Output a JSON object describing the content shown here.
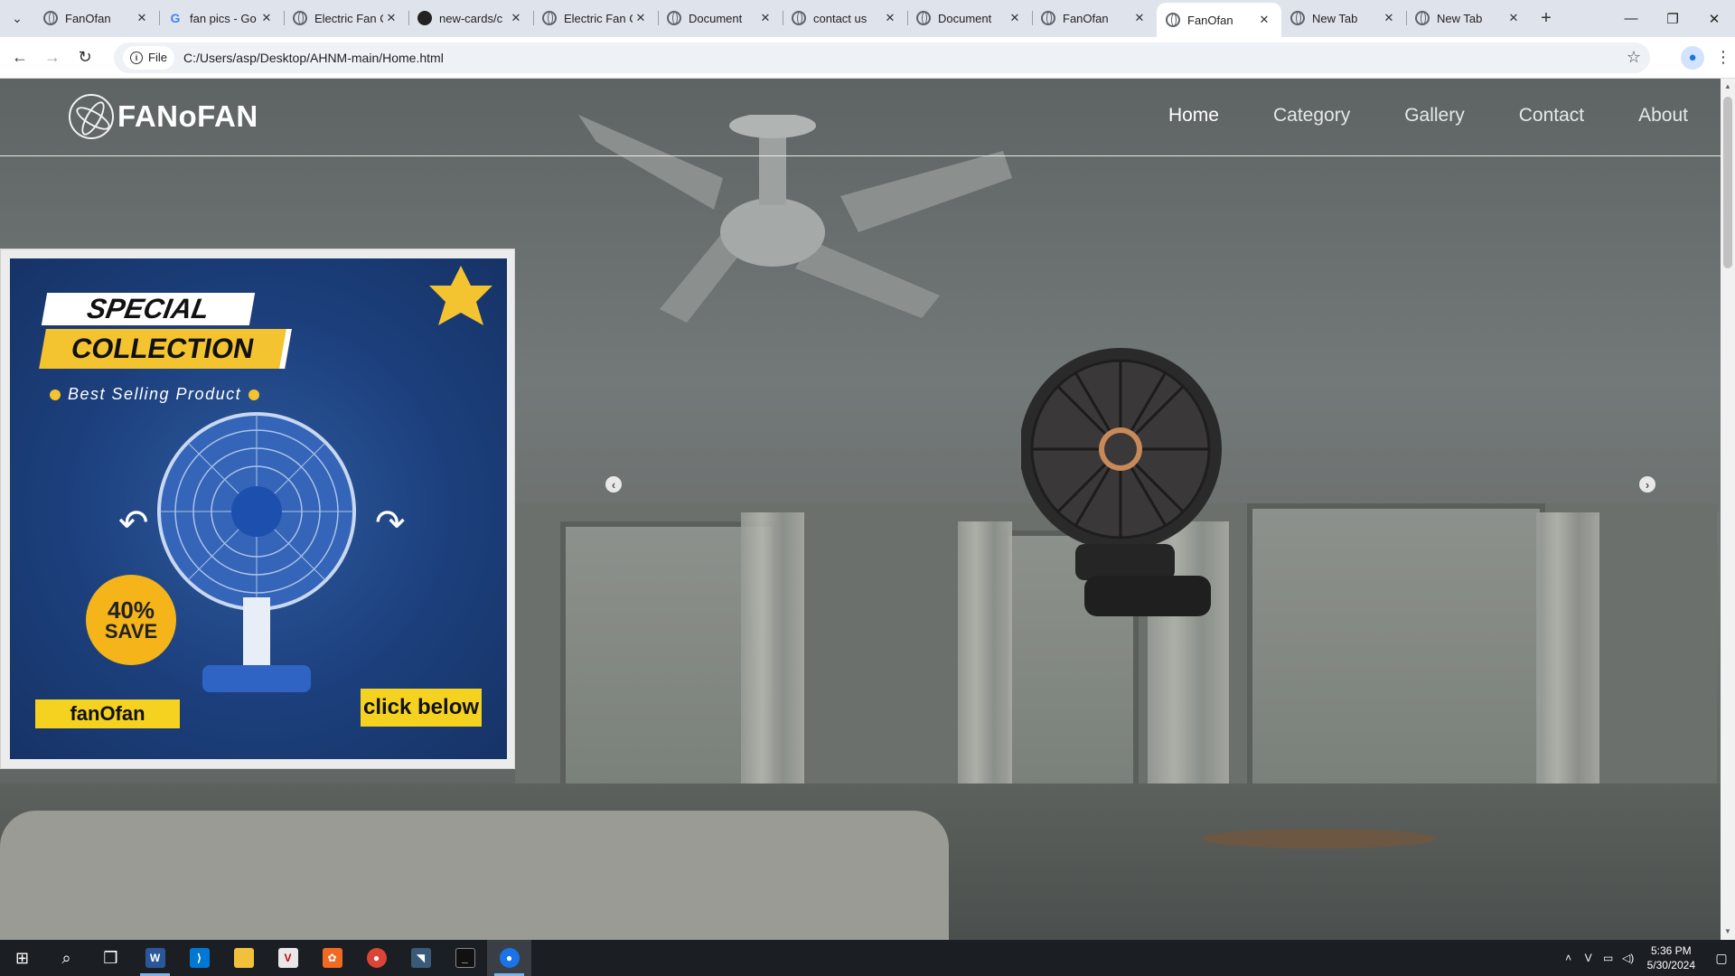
{
  "browser": {
    "tabs": [
      {
        "title": "FanOfan",
        "favicon": "globe-icon",
        "active": false
      },
      {
        "title": "fan pics - Go",
        "favicon": "google-icon",
        "active": false
      },
      {
        "title": "Electric Fan C",
        "favicon": "globe-icon",
        "active": false
      },
      {
        "title": "new-cards/c",
        "favicon": "github-icon",
        "active": false
      },
      {
        "title": "Electric Fan C",
        "favicon": "globe-icon",
        "active": false
      },
      {
        "title": "Document",
        "favicon": "globe-icon",
        "active": false
      },
      {
        "title": "contact us",
        "favicon": "globe-icon",
        "active": false
      },
      {
        "title": "Document",
        "favicon": "globe-icon",
        "active": false
      },
      {
        "title": "FanOfan",
        "favicon": "globe-icon",
        "active": false
      },
      {
        "title": "FanOfan",
        "favicon": "globe-icon",
        "active": true
      },
      {
        "title": "New Tab",
        "favicon": "chrome-icon",
        "active": false
      },
      {
        "title": "New Tab",
        "favicon": "chrome-icon",
        "active": false
      }
    ],
    "site_chip": "File",
    "url": "C:/Users/asp/Desktop/AHNM-main/Home.html"
  },
  "site": {
    "logo_text": "FANoFAN",
    "nav": [
      {
        "label": "Home",
        "active": true
      },
      {
        "label": "Category",
        "active": false
      },
      {
        "label": "Gallery",
        "active": false
      },
      {
        "label": "Contact",
        "active": false
      },
      {
        "label": "About",
        "active": false
      }
    ],
    "promo": {
      "line1": "SPECIAL",
      "line2": "COLLECTION",
      "tagline": "Best Selling Product",
      "save_pct": "40%",
      "save_word": "SAVE",
      "brand": "fanOfan",
      "cta": "click below"
    },
    "carousel": {
      "prev_icon": "chevron-left-icon",
      "next_icon": "chevron-right-icon"
    }
  },
  "taskbar": {
    "time": "5:36 PM",
    "date": "5/30/2024",
    "apps": [
      "windows-start-icon",
      "search-icon",
      "task-view-icon",
      "word-icon",
      "vscode-icon",
      "file-explorer-icon",
      "app-icon",
      "app-icon",
      "chrome-icon",
      "app-icon",
      "terminal-icon",
      "chrome-icon"
    ]
  },
  "colors": {
    "accent_yellow": "#f4d21f",
    "promo_blue": "#1c3f7c",
    "tabstrip": "#dfe3eb"
  }
}
